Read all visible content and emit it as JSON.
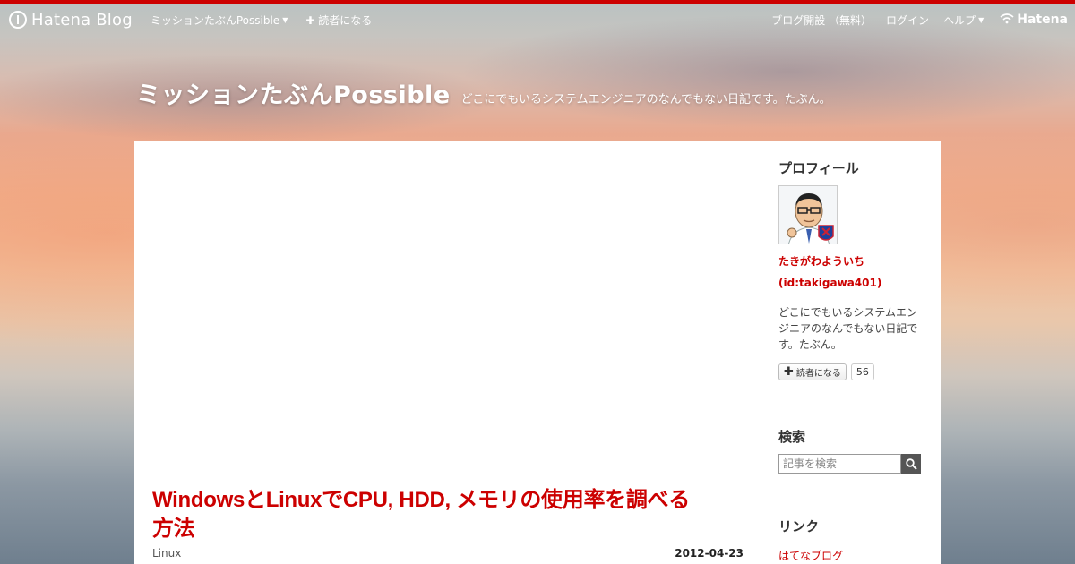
{
  "global_header": {
    "logo_text": "Hatena Blog",
    "blog_menu_label": "ミッションたぶんPossible",
    "subscribe_label": "✚ 読者になる",
    "open_blog_label": "ブログ開設 （無料）",
    "login_label": "ログイン",
    "help_label": "ヘルプ",
    "hatena_label": "Hatena"
  },
  "blog": {
    "title": "ミッションたぶんPossible",
    "description": "どこにでもいるシステムエンジニアのなんでもない日記です。たぶん。"
  },
  "entry": {
    "title": "WindowsとLinuxでCPU, HDD, メモリの使用率を調べる方法",
    "category": "Linux",
    "date": "2012-04-23"
  },
  "sidebar": {
    "profile": {
      "title": "プロフィール",
      "name": "たきがわよういち",
      "id": "(id:takigawa401)",
      "description": "どこにでもいるシステムエンジニアのなんでもない日記です。たぶん。",
      "subscribe_label": "読者になる",
      "subscriber_count": "56"
    },
    "search": {
      "title": "検索",
      "placeholder": "記事を検索"
    },
    "links": {
      "title": "リンク",
      "items": [
        "はてなブログ"
      ]
    }
  },
  "colors": {
    "accent": "#cc0000",
    "top_line": "#cc0000"
  }
}
